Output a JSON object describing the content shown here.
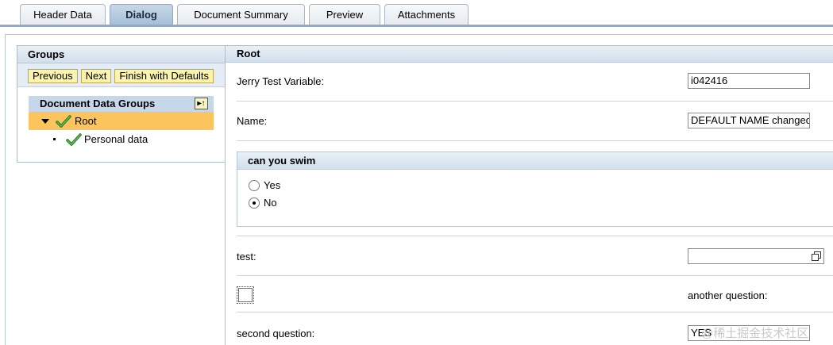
{
  "tabs": [
    {
      "label": "Header Data",
      "active": false
    },
    {
      "label": "Dialog",
      "active": true
    },
    {
      "label": "Document Summary",
      "active": false
    },
    {
      "label": "Preview",
      "active": false
    },
    {
      "label": "Attachments",
      "active": false
    }
  ],
  "groups": {
    "title": "Groups",
    "buttons": {
      "previous": "Previous",
      "next": "Next",
      "finish": "Finish with Defaults"
    },
    "tree_title": "Document Data Groups",
    "root_label": "Root",
    "child_label": "Personal data"
  },
  "content": {
    "title": "Root",
    "jerry_label": "Jerry Test Variable:",
    "jerry_value": "i042416",
    "name_label": "Name:",
    "name_value": "DEFAULT NAME changed",
    "swim": {
      "title": "can you swim",
      "yes": "Yes",
      "no": "No",
      "selected": "No"
    },
    "test_label": "test:",
    "test_value": "",
    "another_label": "another question:",
    "second_label": "second question:",
    "second_value": "YES"
  },
  "watermark": "@稀土掘金技术社区",
  "colors": {
    "accent": "#8eaacb",
    "selected_row": "#fcc45c",
    "button_bg": "#fbf3b0",
    "check": "#2f8f2f"
  },
  "icons": [
    "green-check-icon",
    "collapse-icon",
    "dropdown-list-icon",
    "expand-triangle-icon"
  ]
}
